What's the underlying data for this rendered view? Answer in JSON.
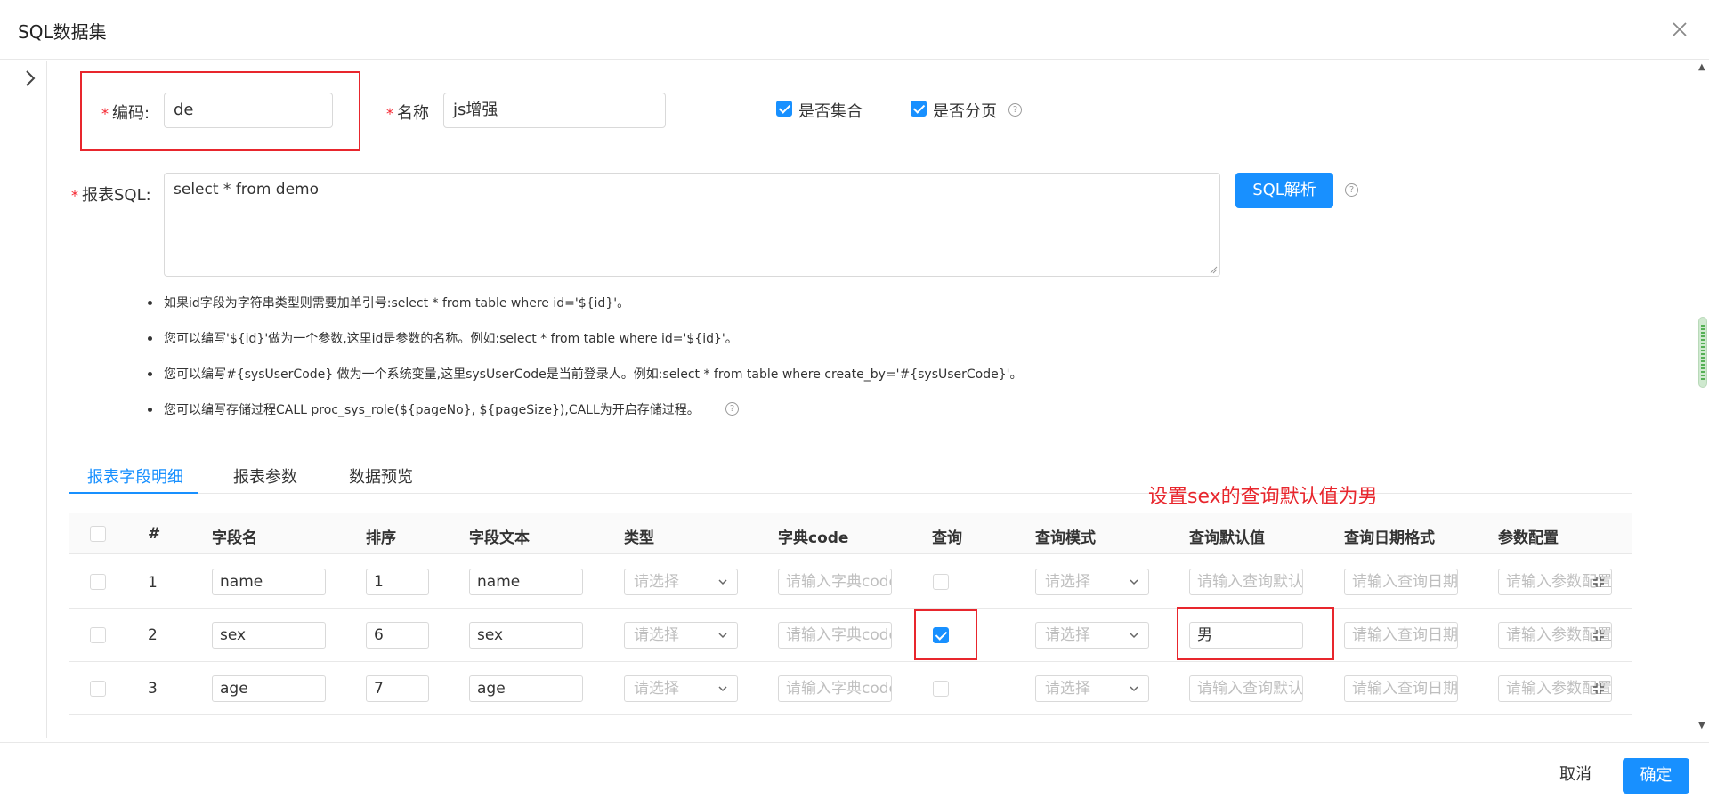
{
  "modal": {
    "title": "SQL数据集"
  },
  "form": {
    "code_label": "编码:",
    "code_value": "de",
    "name_label": "名称",
    "name_value": "js增强",
    "is_collection_label": "是否集合",
    "is_paging_label": "是否分页",
    "sql_label": "报表SQL:",
    "sql_value": "select * from demo",
    "parse_button": "SQL解析",
    "required_mark": "*"
  },
  "tips": [
    "如果id字段为字符串类型则需要加单引号:select * from table where id='${id}'。",
    "您可以编写'${id}'做为一个参数,这里id是参数的名称。例如:select * from table where id='${id}'。",
    "您可以编写#{sysUserCode} 做为一个系统变量,这里sysUserCode是当前登录人。例如:select * from table where create_by='#{sysUserCode}'。",
    "您可以编写存储过程CALL proc_sys_role(${pageNo}, ${pageSize}),CALL为开启存储过程。"
  ],
  "tabs": [
    "报表字段明细",
    "报表参数",
    "数据预览"
  ],
  "annotation": "设置sex的查询默认值为男",
  "table": {
    "headers": [
      "#",
      "字段名",
      "排序",
      "字段文本",
      "类型",
      "字典code",
      "查询",
      "查询模式",
      "查询默认值",
      "查询日期格式",
      "参数配置"
    ],
    "rows": [
      {
        "index": "1",
        "field": "name",
        "order": "1",
        "text": "name",
        "query": false,
        "default": ""
      },
      {
        "index": "2",
        "field": "sex",
        "order": "6",
        "text": "sex",
        "query": true,
        "default": "男"
      },
      {
        "index": "3",
        "field": "age",
        "order": "7",
        "text": "age",
        "query": false,
        "default": ""
      }
    ],
    "placeholders": {
      "type": "请选择",
      "dict": "请输入字典code",
      "mode": "请选择",
      "default": "请输入查询默认值",
      "date_format": "请输入查询日期格式",
      "param": "请输入参数配置"
    }
  },
  "footer": {
    "cancel": "取消",
    "ok": "确定"
  },
  "colors": {
    "primary": "#1890ff",
    "annotation_red": "#e8262d",
    "required": "#f5222d"
  },
  "icons": [
    "close-icon",
    "chevron-right-icon",
    "help-icon",
    "chevron-down-icon",
    "expand-icon",
    "check-icon"
  ]
}
